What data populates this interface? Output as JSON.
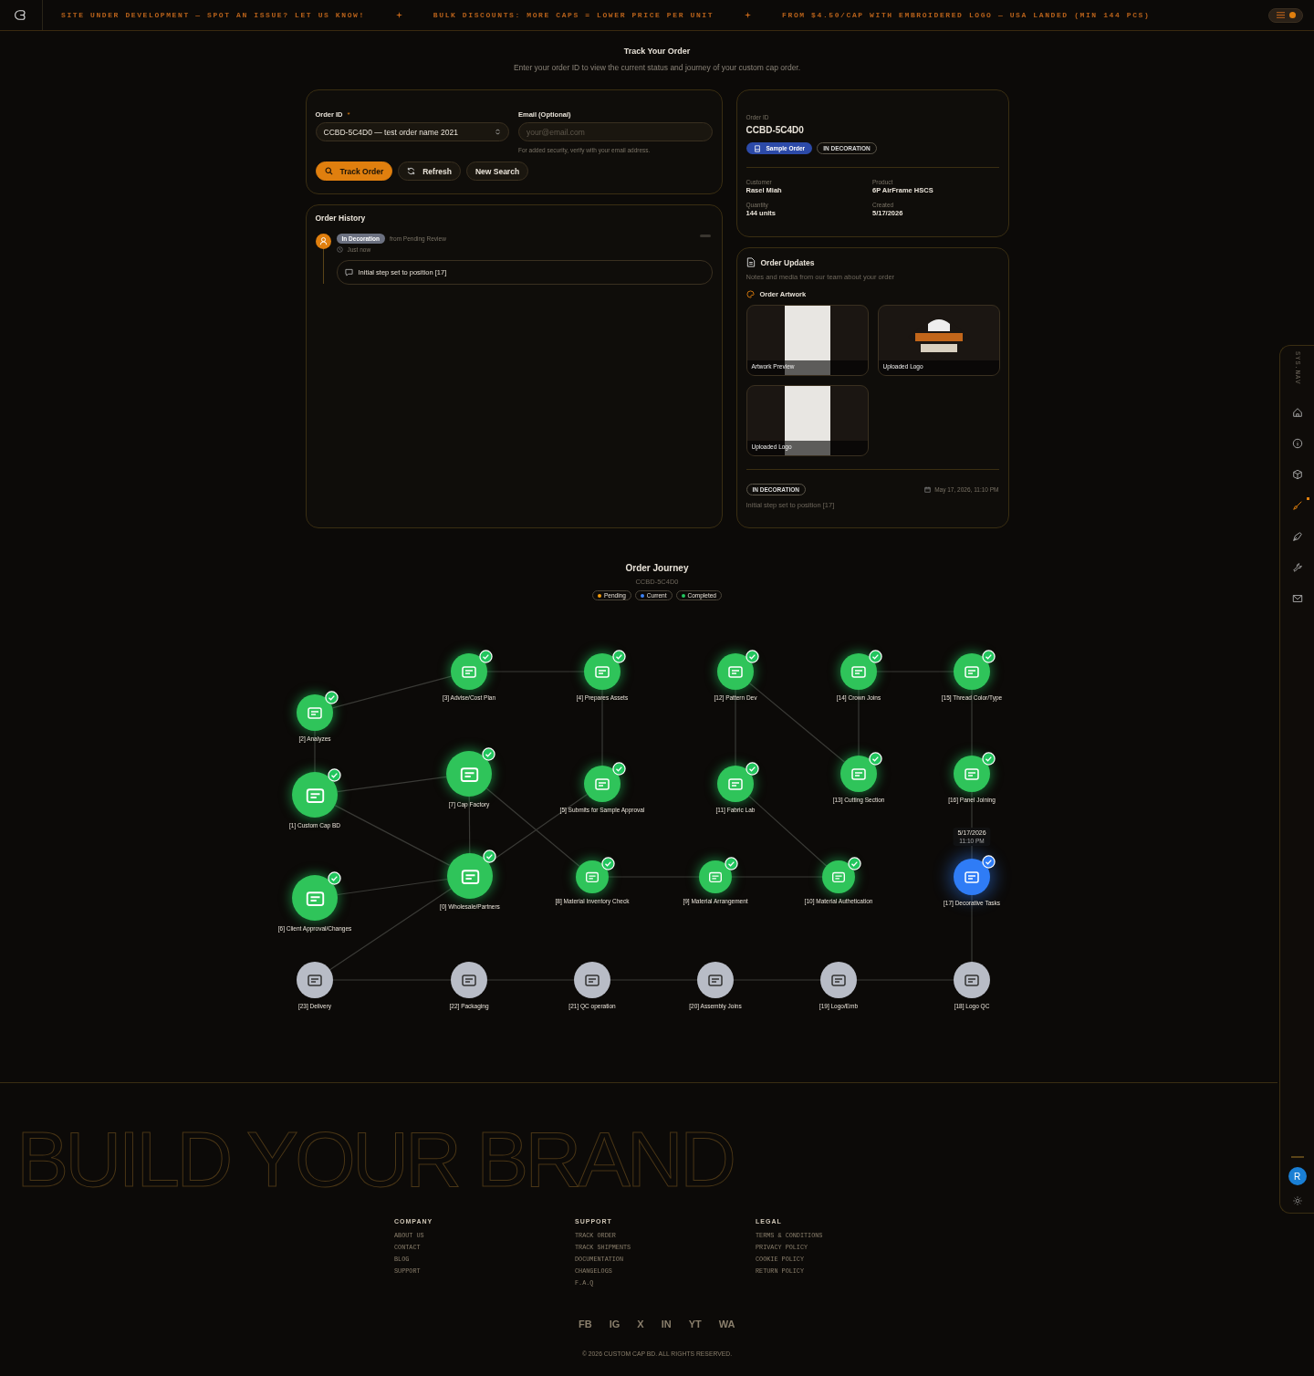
{
  "top_bar": {
    "announcements": [
      "SITE UNDER DEVELOPMENT — SPOT AN ISSUE? LET US KNOW!",
      "BULK DISCOUNTS: MORE CAPS = LOWER PRICE PER UNIT",
      "FROM $4.50/CAP WITH EMBROIDERED LOGO — USA LANDED (MIN 144 PCS)"
    ]
  },
  "header": {
    "title": "Track Your Order",
    "subtitle": "Enter your order ID to view the current status and journey of your custom cap order."
  },
  "search_form": {
    "order_id": {
      "label": "Order ID",
      "required_mark": "*",
      "value": "CCBD-5C4D0 — test order name 2021"
    },
    "email": {
      "label": "Email (Optional)",
      "placeholder": "your@email.com",
      "hint": "For added security, verify with your email address."
    },
    "buttons": [
      {
        "label": "Track Order",
        "kind": "primary"
      },
      {
        "label": "Refresh",
        "kind": "refresh"
      },
      {
        "label": "New Search",
        "kind": "plain"
      }
    ]
  },
  "order_history": {
    "title": "Order History",
    "entries": [
      {
        "status": "In Decoration",
        "from": "from Pending Review",
        "time": "Just now",
        "note": "Initial step set to position [17]"
      }
    ]
  },
  "order_summary": {
    "id_label": "Order ID",
    "order_id": "CCBD-5C4D0",
    "badges": [
      {
        "label": "Sample Order",
        "kind": "type"
      },
      {
        "label": "IN DECORATION",
        "kind": "status"
      }
    ],
    "fields": [
      {
        "label": "Customer",
        "value": "Rasel Miah"
      },
      {
        "label": "Product",
        "value": "6P AirFrame HSCS"
      },
      {
        "label": "Quantity",
        "value": "144 units"
      },
      {
        "label": "Created",
        "value": "5/17/2026"
      }
    ]
  },
  "order_updates": {
    "title": "Order Updates",
    "subtitle": "Notes and media from our team about your order",
    "artwork_title": "Order Artwork",
    "artworks": [
      {
        "caption": "Artwork Preview",
        "kind": "sheet"
      },
      {
        "caption": "Uploaded Logo",
        "kind": "logo"
      },
      {
        "caption": "Uploaded Logo",
        "kind": "sheet"
      }
    ],
    "update": {
      "status": "IN DECORATION",
      "date": "May 17, 2026, 11:10 PM",
      "note": "Initial step set to position [17]"
    }
  },
  "order_journey": {
    "title": "Order Journey",
    "order_id": "CCBD-5C4D0",
    "legend": [
      {
        "label": "Pending",
        "color": "#f59e0b"
      },
      {
        "label": "Current",
        "color": "#3b82f6"
      },
      {
        "label": "Completed",
        "color": "#22c55e"
      }
    ],
    "current_tooltip": {
      "date": "5/17/2026",
      "time": "11:10 PM"
    },
    "nodes": [
      {
        "label": "[3] Advise/Cost Plan",
        "completed": true,
        "current": false
      },
      {
        "label": "[4] Prepares Assets",
        "completed": true,
        "current": false
      },
      {
        "label": "[12] Pattern Dev",
        "completed": true,
        "current": false
      },
      {
        "label": "[14] Crown Joins",
        "completed": true,
        "current": false
      },
      {
        "label": "[15] Thread Color/Type",
        "completed": true,
        "current": false
      },
      {
        "label": "[2] Analyzes",
        "completed": true,
        "current": false
      },
      {
        "label": "[7] Cap Factory",
        "completed": true,
        "current": false
      },
      {
        "label": "[13] Cutting Section",
        "completed": true,
        "current": false
      },
      {
        "label": "[16] Panel Joining",
        "completed": true,
        "current": false
      },
      {
        "label": "[5] Submits for Sample Approval",
        "completed": true,
        "current": false
      },
      {
        "label": "[11] Fabric Lab",
        "completed": true,
        "current": false
      },
      {
        "label": "[1] Custom Cap BD",
        "completed": true,
        "current": false
      },
      {
        "label": "[0] Wholesale/Partners",
        "completed": true,
        "current": false
      },
      {
        "label": "[8] Material Inventory Check",
        "completed": true,
        "current": false
      },
      {
        "label": "[9] Material Arrangement",
        "completed": true,
        "current": false
      },
      {
        "label": "[10] Material Authetication",
        "completed": true,
        "current": false
      },
      {
        "label": "[17] Decorative Tasks",
        "completed": false,
        "current": true
      },
      {
        "label": "[6] Client Approval/Changes",
        "completed": true,
        "current": false
      },
      {
        "label": "[23] Delivery",
        "completed": false,
        "current": false
      },
      {
        "label": "[22] Packaging",
        "completed": false,
        "current": false
      },
      {
        "label": "[21] QC operation",
        "completed": false,
        "current": false
      },
      {
        "label": "[20] Assembly Joins",
        "completed": false,
        "current": false
      },
      {
        "label": "[19] Logo/Emb",
        "completed": false,
        "current": false
      },
      {
        "label": "[18] Logo QC",
        "completed": false,
        "current": false
      }
    ]
  },
  "footer": {
    "slogan": "BUILD YOUR BRAND",
    "columns": [
      {
        "title": "COMPANY",
        "links": [
          "ABOUT US",
          "CONTACT",
          "BLOG",
          "SUPPORT"
        ]
      },
      {
        "title": "SUPPORT",
        "links": [
          "TRACK ORDER",
          "TRACK SHIPMENTS",
          "DOCUMENTATION",
          "CHANGELOGS",
          "F.A.Q"
        ]
      },
      {
        "title": "LEGAL",
        "links": [
          "TERMS & CONDITIONS",
          "PRIVACY POLICY",
          "COOKIE POLICY",
          "RETURN POLICY"
        ]
      }
    ],
    "socials": [
      "FB",
      "IG",
      "X",
      "IN",
      "YT",
      "WA"
    ],
    "copyright": "© 2026 CUSTOM CAP BD. ALL RIGHTS RESERVED."
  },
  "side_nav": {
    "label": "SYS.NAV",
    "items": [
      {
        "kind": "home",
        "selected": false
      },
      {
        "kind": "info",
        "selected": false
      },
      {
        "kind": "box",
        "selected": false
      },
      {
        "kind": "brush",
        "selected": true
      },
      {
        "kind": "pen",
        "selected": false
      },
      {
        "kind": "wrench",
        "selected": false
      },
      {
        "kind": "mail",
        "selected": false
      }
    ],
    "avatar": "R"
  }
}
